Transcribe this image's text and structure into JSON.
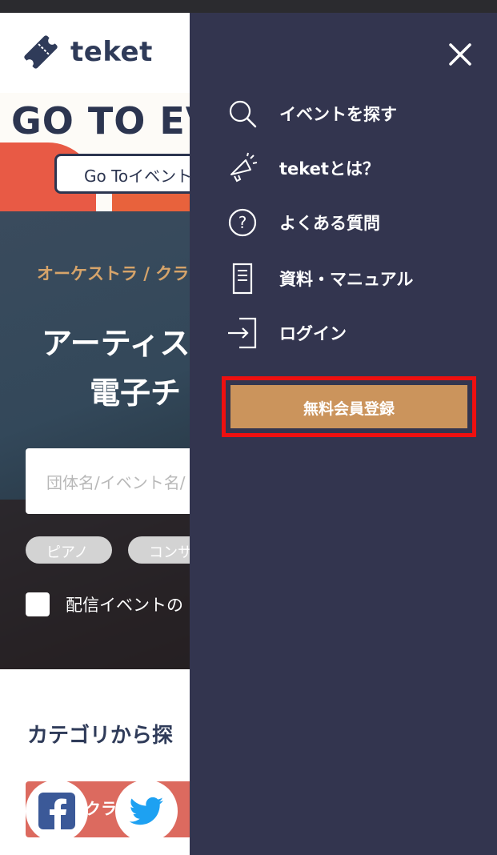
{
  "brand": {
    "name": "teket"
  },
  "banner": {
    "title": "GO TO EV",
    "pill_text": "Go Toイベント"
  },
  "hero": {
    "subtitle": "オーケストラ / クラ",
    "title_line1": "アーティス",
    "title_line2": "電子チ",
    "search_placeholder": "団体名/イベント名/",
    "tags": [
      "ピアノ",
      "コンサ"
    ],
    "checkbox_label": "配信イベントの"
  },
  "category": {
    "title": "カテゴリから探",
    "card_label": "クラ"
  },
  "social": [
    "facebook-icon",
    "twitter-icon"
  ],
  "menu": {
    "items": [
      {
        "label": "イベントを探す",
        "icon": "search-icon"
      },
      {
        "label": "teketとは？",
        "icon": "megaphone-icon"
      },
      {
        "label": "よくある質問",
        "icon": "question-icon"
      },
      {
        "label": "資料・マニュアル",
        "icon": "document-icon"
      },
      {
        "label": "ログイン",
        "icon": "login-icon"
      }
    ],
    "register_label": "無料会員登録"
  },
  "colors": {
    "menu_bg": "#33354f",
    "register_bg": "#cb945c",
    "highlight": "#ee1010",
    "brand_navy": "#2f3b59",
    "accent_gold": "#d6a46a"
  }
}
